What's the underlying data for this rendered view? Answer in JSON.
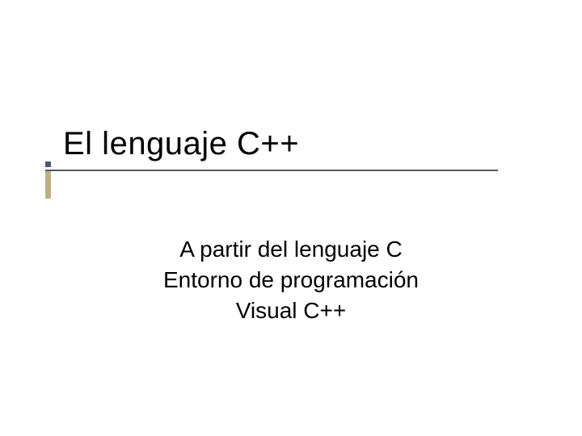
{
  "slide": {
    "title": "El lenguaje C++",
    "subtitle": {
      "line1": "A partir del lenguaje C",
      "line2": "Entorno de programación",
      "line3": "Visual C++"
    },
    "accent_colors": {
      "bar": "#beae81",
      "line": "#4b5a6b"
    }
  }
}
